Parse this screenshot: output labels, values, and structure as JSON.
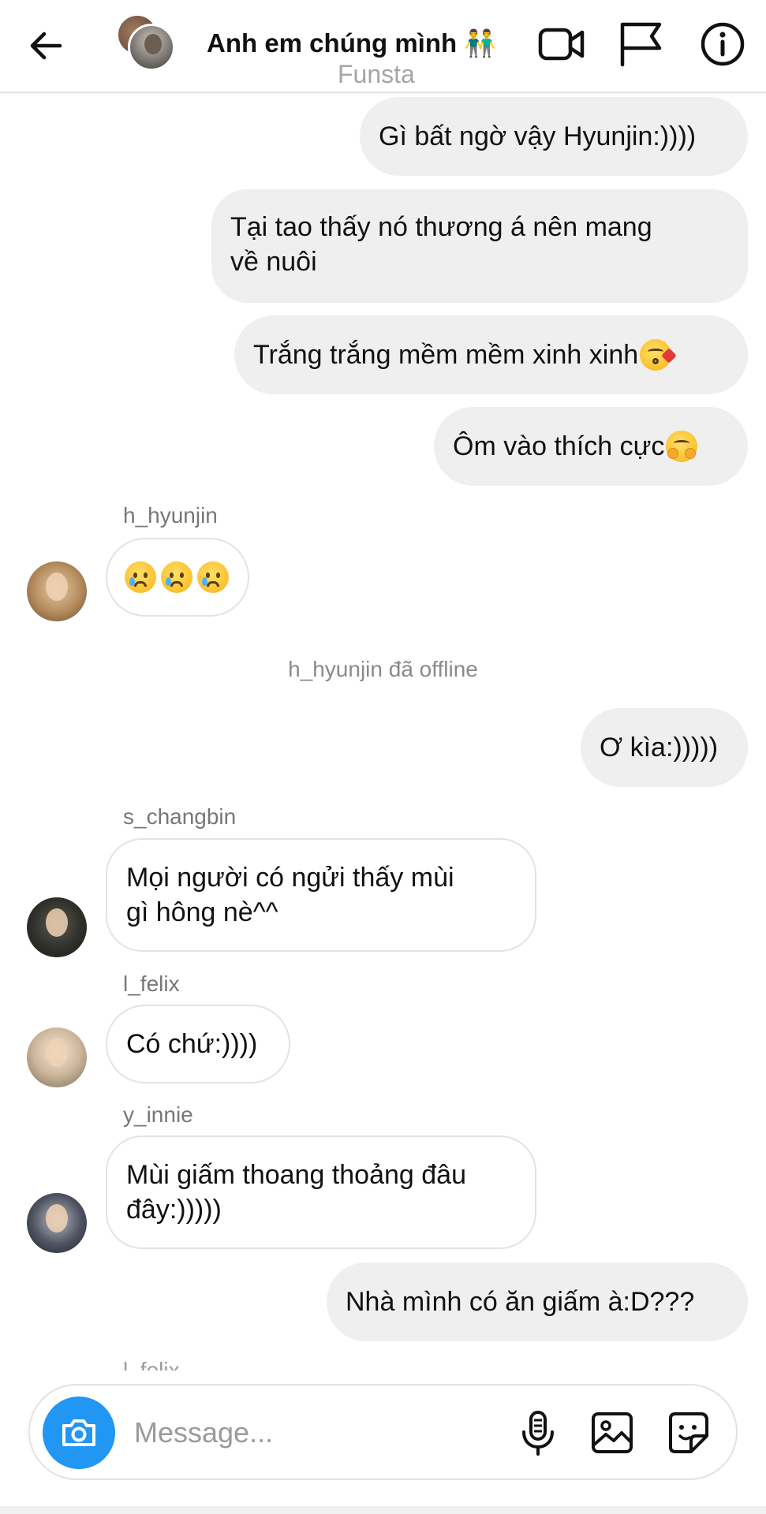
{
  "header": {
    "title": "Anh em chúng mình 👬",
    "subtitle": "Funsta"
  },
  "messages": {
    "m1": "Gì bất ngờ vậy Hyunjin:))))",
    "m2_line1": "Tại tao thấy nó thương á nên mang",
    "m2_line2": "về nuôi",
    "m3": "Trắng trắng mềm mềm xinh xinh",
    "m4": "Ôm vào thích cực",
    "hyunjin_name": "h_hyunjin",
    "system_offline": "h_hyunjin đã offline",
    "m5": "Ơ kìa:)))))",
    "changbin_name": "s_changbin",
    "m6_line1": "Mọi người có ngửi thấy mùi",
    "m6_line2": "gì hông nè^^",
    "felix_name": "l_felix",
    "m7": "Có chứ:))))",
    "innie_name": "y_innie",
    "m8_line1": "Mùi giấm thoang thoảng đâu",
    "m8_line2": "đây:)))))",
    "m9": "Nhà mình có ăn giấm à:D???",
    "partial_name": "l_felix"
  },
  "composer": {
    "placeholder": "Message..."
  },
  "icons": {
    "back": "arrow-left-icon",
    "video": "video-camera-icon",
    "flag": "flag-icon",
    "info": "info-icon",
    "camera": "camera-icon",
    "mic": "microphone-icon",
    "gallery": "image-icon",
    "sticker": "sticker-icon"
  },
  "colors": {
    "accent": "#2196f3",
    "bubble_out": "#efefef",
    "bubble_in_border": "#e3e3e3"
  }
}
